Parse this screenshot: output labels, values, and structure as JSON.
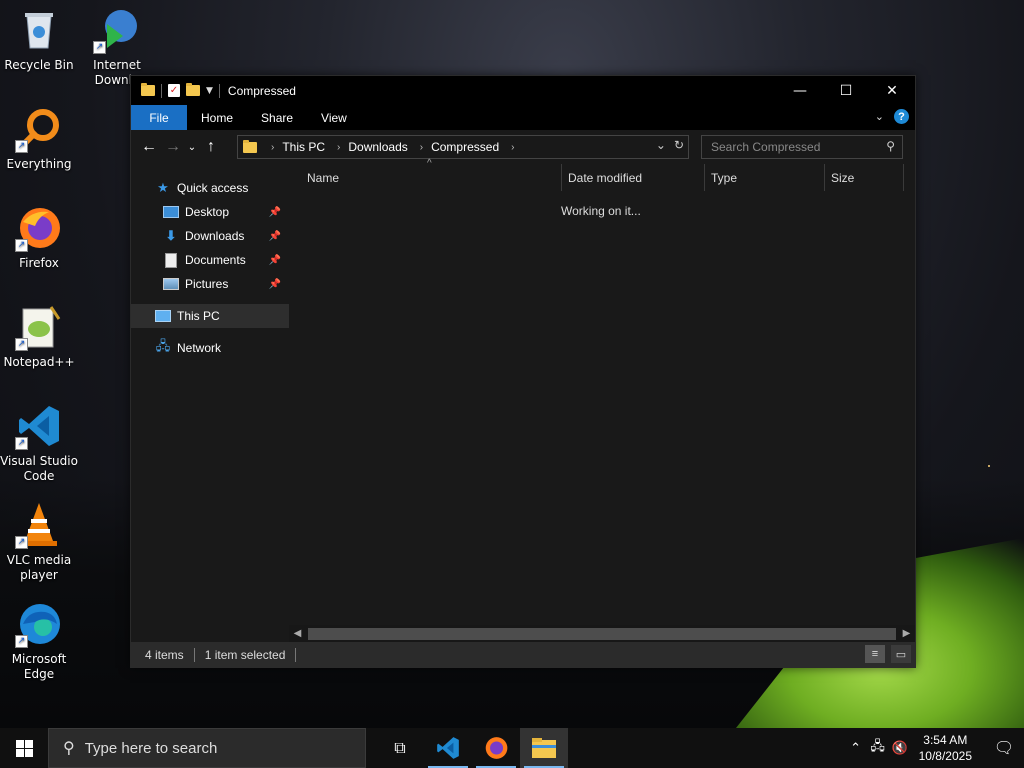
{
  "desktop": {
    "icons": [
      {
        "label": "Recycle Bin",
        "icon": "recycle-bin-icon"
      },
      {
        "label": "Internet Downlo",
        "icon": "internet-download-manager-icon"
      },
      {
        "label": "Everything",
        "icon": "everything-search-icon"
      },
      {
        "label": "Firefox",
        "icon": "firefox-icon"
      },
      {
        "label": "Notepad++",
        "icon": "notepad-plus-plus-icon"
      },
      {
        "label": "Visual Studio Code",
        "icon": "vscode-icon"
      },
      {
        "label": "VLC media player",
        "icon": "vlc-icon"
      },
      {
        "label": "Microsoft Edge",
        "icon": "edge-icon"
      }
    ]
  },
  "explorer": {
    "title": "Compressed",
    "window_controls": {
      "minimize": "—",
      "maximize": "☐",
      "close": "✕"
    },
    "ribbon_tabs": [
      "File",
      "Home",
      "Share",
      "View"
    ],
    "help_label": "?",
    "address": {
      "crumbs": [
        "This PC",
        "Downloads",
        "Compressed"
      ]
    },
    "search": {
      "placeholder": "Search Compressed"
    },
    "sidebar": {
      "quick_access": "Quick access",
      "items": [
        {
          "label": "Desktop",
          "icon": "desktop-folder-icon",
          "pinned": true
        },
        {
          "label": "Downloads",
          "icon": "downloads-folder-icon",
          "pinned": true
        },
        {
          "label": "Documents",
          "icon": "documents-folder-icon",
          "pinned": true
        },
        {
          "label": "Pictures",
          "icon": "pictures-folder-icon",
          "pinned": true
        }
      ],
      "this_pc": "This PC",
      "network": "Network"
    },
    "columns": [
      "Name",
      "Date modified",
      "Type",
      "Size"
    ],
    "status_message": "Working on it...",
    "statusbar": {
      "items_count": "4 items",
      "selected": "1 item selected"
    }
  },
  "taskbar": {
    "search_placeholder": "Type here to search",
    "time": "3:54 AM",
    "date": "10/8/2025"
  },
  "colors": {
    "accent": "#1a6fc4",
    "window_bg": "#191919",
    "title_bg": "#000000"
  }
}
